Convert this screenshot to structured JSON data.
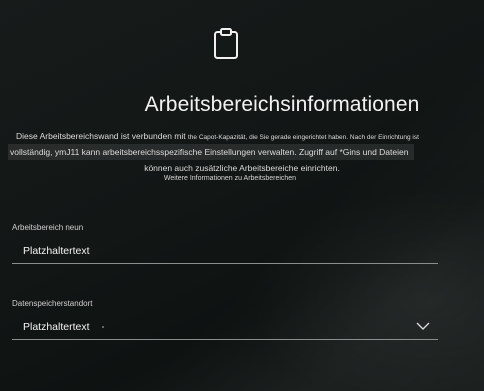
{
  "header": {
    "icon": "clipboard-icon",
    "title": "Arbeitsbereichsinformationen"
  },
  "description": {
    "line1_a": "Diese Arbeitsbereichswand ist verbunden mit",
    "line1_b": "the Capot-Kapazität, die Sie gerade eingerichtet haben. Nach der Einrichtung ist",
    "line2": "vollständig, ymJ11 kann arbeitsbereichsspezifische Einstellungen verwalten. Zugriff auf *Gins und Dateien",
    "line3": "können auch zusätzliche Arbeitsbereiche einrichten."
  },
  "learn_more": "Weitere Informationen zu Arbeitsbereichen",
  "form": {
    "workspace_label": "Arbeitsbereich neun",
    "workspace_value": "Platzhaltertext",
    "storage_label": "Datenspeicherstandort",
    "storage_value": "Platzhaltertext",
    "storage_icon": "chevron-down-icon"
  },
  "colors": {
    "background": "#141817",
    "text": "#e8e8e8",
    "underline": "#8a8e8d"
  }
}
